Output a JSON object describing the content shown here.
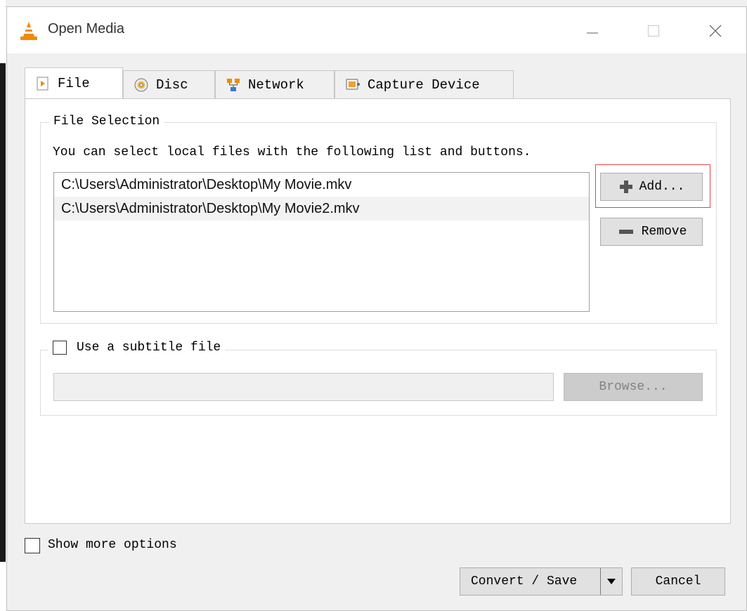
{
  "window": {
    "title": "Open Media",
    "controls": {
      "minimize": "minimize-icon",
      "maximize": "maximize-icon",
      "close": "close-icon"
    }
  },
  "tabs": [
    {
      "label": "File",
      "icon": "file-icon",
      "active": true
    },
    {
      "label": "Disc",
      "icon": "disc-icon",
      "active": false
    },
    {
      "label": "Network",
      "icon": "network-icon",
      "active": false
    },
    {
      "label": "Capture Device",
      "icon": "capture-device-icon",
      "active": false
    }
  ],
  "file_selection": {
    "title": "File Selection",
    "hint": "You can select local files with the following list and buttons.",
    "files": [
      "C:\\Users\\Administrator\\Desktop\\My Movie.mkv",
      "C:\\Users\\Administrator\\Desktop\\My Movie2.mkv"
    ],
    "add_label": "Add...",
    "remove_label": "Remove"
  },
  "subtitle": {
    "checkbox_label": "Use a subtitle file",
    "checked": false,
    "path_value": "",
    "browse_label": "Browse..."
  },
  "footer": {
    "show_more_label": "Show more options",
    "show_more_checked": false,
    "convert_label": "Convert / Save",
    "cancel_label": "Cancel"
  },
  "colors": {
    "highlight": "#e04848",
    "vlc_orange": "#f08a00"
  }
}
